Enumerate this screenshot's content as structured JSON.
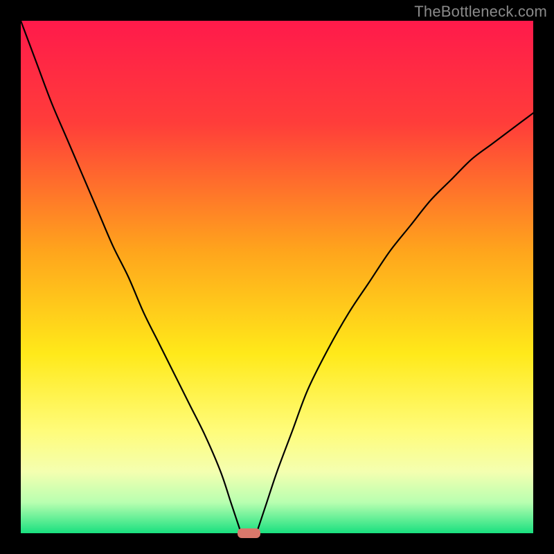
{
  "watermark": "TheBottleneck.com",
  "chart_data": {
    "type": "line",
    "title": "",
    "xlabel": "",
    "ylabel": "",
    "xlim": [
      0,
      100
    ],
    "ylim": [
      0,
      100
    ],
    "grid": false,
    "legend": false,
    "gradient_stops": [
      {
        "pct": 0,
        "color": "#ff1a4b"
      },
      {
        "pct": 20,
        "color": "#ff3d3a"
      },
      {
        "pct": 45,
        "color": "#ffa51c"
      },
      {
        "pct": 65,
        "color": "#ffe91a"
      },
      {
        "pct": 80,
        "color": "#fffc7a"
      },
      {
        "pct": 88,
        "color": "#f4ffb0"
      },
      {
        "pct": 94,
        "color": "#b8ffb0"
      },
      {
        "pct": 100,
        "color": "#19e07f"
      }
    ],
    "series": [
      {
        "name": "left-branch",
        "x": [
          0,
          3,
          6,
          9,
          12,
          15,
          18,
          21,
          24,
          27,
          30,
          33,
          36,
          39,
          41,
          42,
          43
        ],
        "values": [
          100,
          92,
          84,
          77,
          70,
          63,
          56,
          50,
          43,
          37,
          31,
          25,
          19,
          12,
          6,
          3,
          0
        ]
      },
      {
        "name": "right-branch",
        "x": [
          46,
          48,
          50,
          53,
          56,
          60,
          64,
          68,
          72,
          76,
          80,
          84,
          88,
          92,
          96,
          100
        ],
        "values": [
          0,
          6,
          12,
          20,
          28,
          36,
          43,
          49,
          55,
          60,
          65,
          69,
          73,
          76,
          79,
          82
        ]
      }
    ],
    "marker": {
      "x_center": 44.5,
      "y": 0,
      "width": 4.5,
      "height": 1.8,
      "color": "#d9786b"
    }
  }
}
